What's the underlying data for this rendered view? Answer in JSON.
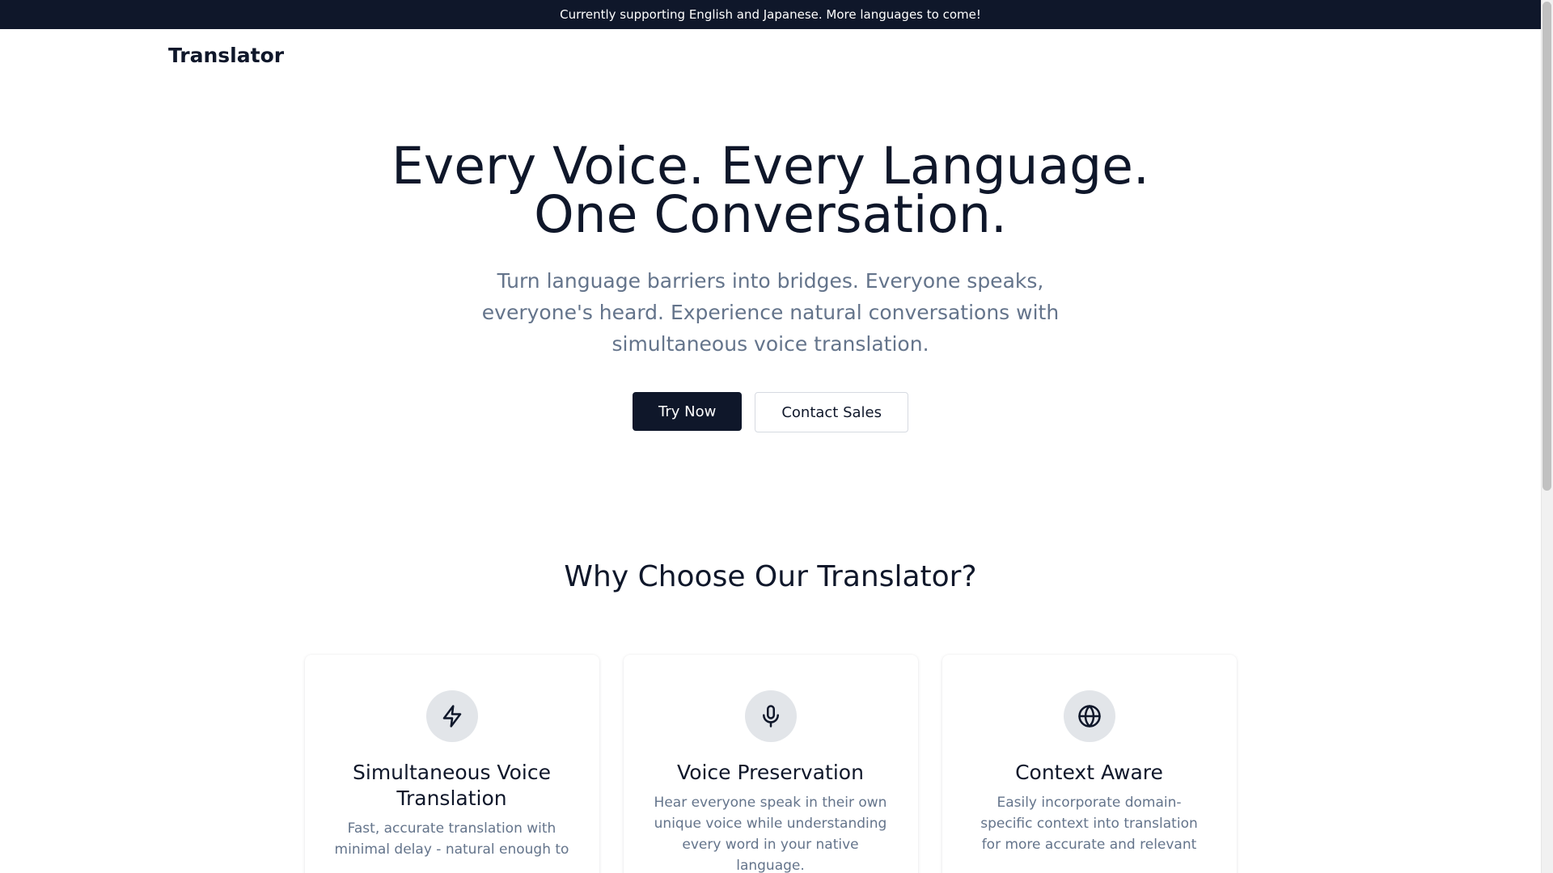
{
  "banner": {
    "text": "Currently supporting English and Japanese. More languages to come!"
  },
  "navbar": {
    "logo": "Translator"
  },
  "hero": {
    "title_line1": "Every Voice. Every Language.",
    "title_line2": "One Conversation.",
    "subtitle": "Turn language barriers into bridges. Everyone speaks, everyone's heard. Experience natural conversations with simultaneous voice translation.",
    "primary_cta": "Try Now",
    "secondary_cta": "Contact Sales"
  },
  "features": {
    "title": "Why Choose Our Translator?",
    "cards": [
      {
        "icon": "lightning-icon",
        "title": "Simultaneous Voice Translation",
        "description": "Fast, accurate translation with minimal delay - natural enough to"
      },
      {
        "icon": "microphone-icon",
        "title": "Voice Preservation",
        "description": "Hear everyone speak in their own unique voice while understanding every word in your native language."
      },
      {
        "icon": "globe-icon",
        "title": "Context Aware",
        "description": "Easily incorporate domain-specific context into translation for more accurate and relevant"
      }
    ]
  },
  "colors": {
    "primary": "#0f172a",
    "muted_text": "#64748b",
    "icon_bg": "#e2e5e9"
  }
}
